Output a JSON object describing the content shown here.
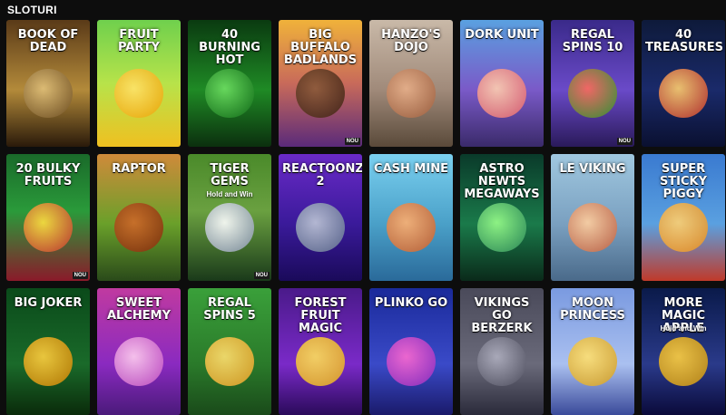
{
  "section": {
    "title": "SLOTURI"
  },
  "badge_label": "NOU",
  "games": [
    {
      "title": "Book of Dead",
      "sub": "",
      "new": false
    },
    {
      "title": "Fruit Party",
      "sub": "",
      "new": false
    },
    {
      "title": "40 Burning Hot",
      "sub": "",
      "new": false
    },
    {
      "title": "Big Buffalo Badlands",
      "sub": "",
      "new": true
    },
    {
      "title": "Hanzo's Dojo",
      "sub": "",
      "new": false
    },
    {
      "title": "Dork Unit",
      "sub": "",
      "new": false
    },
    {
      "title": "Regal Spins 10",
      "sub": "",
      "new": true
    },
    {
      "title": "40 Treasures",
      "sub": "",
      "new": false
    },
    {
      "title": "20 Bulky Fruits",
      "sub": "",
      "new": true
    },
    {
      "title": "Raptor",
      "sub": "",
      "new": false
    },
    {
      "title": "Tiger Gems",
      "sub": "Hold and Win",
      "new": true
    },
    {
      "title": "Reactoonz 2",
      "sub": "",
      "new": false
    },
    {
      "title": "Cash Mine",
      "sub": "",
      "new": false
    },
    {
      "title": "Astro Newts Megaways",
      "sub": "",
      "new": false
    },
    {
      "title": "Le Viking",
      "sub": "",
      "new": false
    },
    {
      "title": "Super Sticky Piggy",
      "sub": "",
      "new": false
    },
    {
      "title": "Big Joker",
      "sub": "",
      "new": false
    },
    {
      "title": "Sweet Alchemy",
      "sub": "",
      "new": false
    },
    {
      "title": "Regal Spins 5",
      "sub": "",
      "new": false
    },
    {
      "title": "Forest Fruit Magic",
      "sub": "",
      "new": false
    },
    {
      "title": "Plinko Go",
      "sub": "",
      "new": false
    },
    {
      "title": "Vikings go Berzerk",
      "sub": "",
      "new": false
    },
    {
      "title": "Moon Princess",
      "sub": "",
      "new": false
    },
    {
      "title": "More Magic Apple",
      "sub": "Hold and Win",
      "new": false
    }
  ]
}
